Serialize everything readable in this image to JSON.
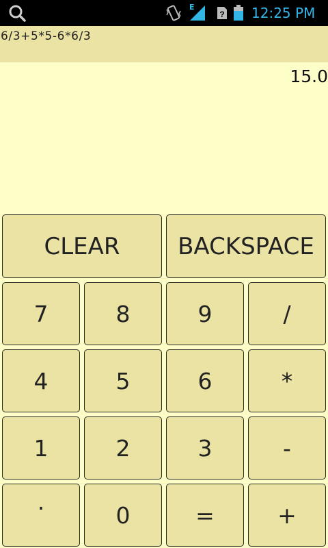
{
  "status_bar": {
    "time": "12:25 PM",
    "network_label": "E",
    "icons": [
      "search-icon",
      "vibrate-icon",
      "signal-icon",
      "sim-icon",
      "battery-icon"
    ],
    "colors": {
      "background": "#000000",
      "accent": "#33b5e5"
    }
  },
  "display": {
    "expression": "6/3+5*5-6*6/3",
    "result": "15.0"
  },
  "buttons": {
    "clear": "CLEAR",
    "backspace": "BACKSPACE",
    "seven": "7",
    "eight": "8",
    "nine": "9",
    "divide": "/",
    "four": "4",
    "five": "5",
    "six": "6",
    "multiply": "*",
    "one": "1",
    "two": "2",
    "three": "3",
    "minus": "-",
    "dot": ".",
    "zero": "0",
    "equals": "=",
    "plus": "+"
  },
  "colors": {
    "background": "#fefec8",
    "button": "#ebe3a4",
    "button_border": "#2a2a20"
  }
}
